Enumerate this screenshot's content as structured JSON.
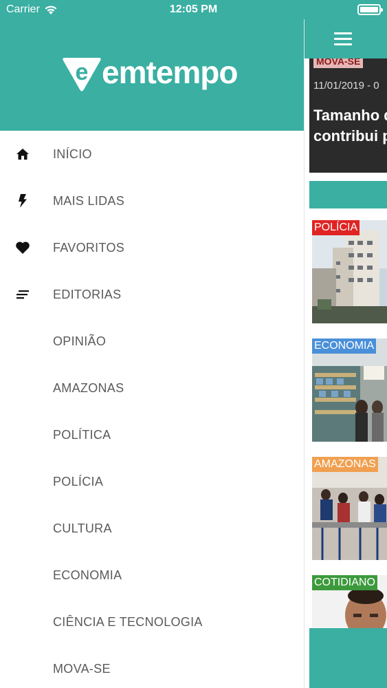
{
  "status_bar": {
    "carrier": "Carrier",
    "time": "12:05 PM"
  },
  "brand": {
    "logo_text": "emtempo",
    "accent_color": "#3aafa2"
  },
  "menu": {
    "items": [
      {
        "label": "INÍCIO",
        "icon": "home-icon"
      },
      {
        "label": "MAIS LIDAS",
        "icon": "lightning-icon"
      },
      {
        "label": "FAVORITOS",
        "icon": "heart-icon"
      },
      {
        "label": "EDITORIAS",
        "icon": "list-icon"
      },
      {
        "label": "OPINIÃO",
        "icon": ""
      },
      {
        "label": "AMAZONAS",
        "icon": ""
      },
      {
        "label": "POLÍTICA",
        "icon": ""
      },
      {
        "label": "POLÍCIA",
        "icon": ""
      },
      {
        "label": "CULTURA",
        "icon": ""
      },
      {
        "label": "ECONOMIA",
        "icon": ""
      },
      {
        "label": "CIÊNCIA E TECNOLOGIA",
        "icon": ""
      },
      {
        "label": "MOVA-SE",
        "icon": ""
      }
    ]
  },
  "feed": {
    "hero": {
      "tag": "MOVA-SE",
      "date": "11/01/2019 - 0",
      "title_line1": "Tamanho d",
      "title_line2": "contribui p"
    },
    "cards": [
      {
        "tag": "POLÍCIA",
        "tag_color": "#e02424"
      },
      {
        "tag": "ECONOMIA",
        "tag_color": "#4a90d9"
      },
      {
        "tag": "AMAZONAS",
        "tag_color": "#f0a050"
      },
      {
        "tag": "COTIDIANO",
        "tag_color": "#3c9a3c"
      }
    ]
  }
}
